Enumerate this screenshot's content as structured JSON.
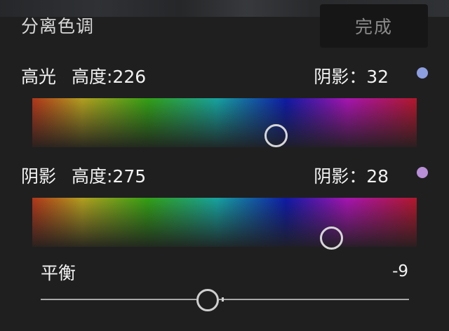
{
  "panel": {
    "title": "分离色调",
    "done_label": "完成"
  },
  "highlights": {
    "label": "高光",
    "hue_label": "高度:226",
    "saturation_label": "阴影：32",
    "swatch_color": "#8d9ee0",
    "hue": 226,
    "saturation": 32
  },
  "shadows": {
    "label": "阴影",
    "hue_label": "高度:275",
    "saturation_label": "阴影：28",
    "swatch_color": "#b98fd8",
    "hue": 275,
    "saturation": 28
  },
  "balance": {
    "label": "平衡",
    "value_text": "-9",
    "value": -9,
    "min": -100,
    "max": 100
  },
  "colors": {
    "background": "#1f1f1f",
    "done_button_bg": "#161616",
    "ring": "#d6d6d6"
  }
}
